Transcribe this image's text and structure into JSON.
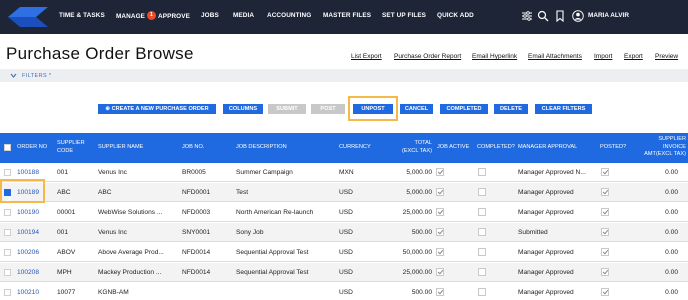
{
  "nav": {
    "items": [
      "TIME & TASKS",
      "MANAGE",
      "APPROVE",
      "JOBS",
      "MEDIA",
      "ACCOUNTING",
      "MASTER FILES",
      "SET UP FILES",
      "QUICK ADD"
    ],
    "badge": "1",
    "user_name": "MARIA ALVIR",
    "icons": [
      "logo-icon",
      "sliders-icon",
      "search-icon",
      "bookmark-icon",
      "user-icon"
    ]
  },
  "page": {
    "title": "Purchase Order Browse",
    "links": [
      "List Export",
      "Purchase Order Report",
      "Email Hyperlink",
      "Email Attachments",
      "Import",
      "Export",
      "Preview"
    ]
  },
  "filters": {
    "label": "FILTERS *"
  },
  "actions": {
    "create": "⊕ CREATE A NEW PURCHASE ORDER",
    "columns": "COLUMNS",
    "submit": "SUBMIT",
    "post": "POST",
    "unpost": "UNPOST",
    "cancel": "CANCEL",
    "completed": "COMPLETED",
    "delete": "DELETE",
    "clear_filters": "CLEAR FILTERS"
  },
  "table": {
    "headers": {
      "order_no": "ORDER NO",
      "supplier_code": [
        "SUPPLIER",
        "CODE"
      ],
      "supplier_name": "SUPPLIER NAME",
      "job_no": "JOB NO.",
      "job_description": "JOB DESCRIPTION",
      "currency": "CURRENCY",
      "total": [
        "TOTAL",
        "(EXCL TAX)"
      ],
      "job_active": "JOB ACTIVE",
      "completed": "COMPLETED?",
      "manager_approval": "MANAGER APPROVAL",
      "posted": "POSTED?",
      "supplier_invoice": [
        "SUPPLIER",
        "INVOICE",
        "AMT(EXCL TAX)"
      ]
    },
    "rows": [
      {
        "selected": false,
        "order_no": "100188",
        "supplier_code": "001",
        "supplier_name": "Venus Inc",
        "job_no": "BR0005",
        "job_description": "Summer Campaign",
        "currency": "MXN",
        "total": "5,000.00",
        "job_active": true,
        "completed": false,
        "manager_approval": "Manager Approved N...",
        "posted": true,
        "supplier_invoice": "0.00"
      },
      {
        "selected": true,
        "order_no": "100189",
        "supplier_code": "ABC",
        "supplier_name": "ABC",
        "job_no": "NFD0001",
        "job_description": "Test",
        "currency": "USD",
        "total": "5,000.00",
        "job_active": true,
        "completed": false,
        "manager_approval": "Manager Approved",
        "posted": true,
        "supplier_invoice": "0.00"
      },
      {
        "selected": false,
        "order_no": "100190",
        "supplier_code": "00001",
        "supplier_name": "WebWise Solutions ...",
        "job_no": "NFD0003",
        "job_description": "North American Re-launch",
        "currency": "USD",
        "total": "25,000.00",
        "job_active": true,
        "completed": false,
        "manager_approval": "Manager Approved",
        "posted": true,
        "supplier_invoice": "0.00"
      },
      {
        "selected": false,
        "order_no": "100194",
        "supplier_code": "001",
        "supplier_name": "Venus Inc",
        "job_no": "SNY0001",
        "job_description": "Sony Job",
        "currency": "USD",
        "total": "500.00",
        "job_active": true,
        "completed": false,
        "manager_approval": "Submitted",
        "posted": true,
        "supplier_invoice": "0.00"
      },
      {
        "selected": false,
        "order_no": "100206",
        "supplier_code": "ABOV",
        "supplier_name": "Above Average Prod...",
        "job_no": "NFD0014",
        "job_description": "Sequential Approval Test",
        "currency": "USD",
        "total": "50,000.00",
        "job_active": true,
        "completed": false,
        "manager_approval": "Manager Approved",
        "posted": true,
        "supplier_invoice": "0.00"
      },
      {
        "selected": false,
        "order_no": "100208",
        "supplier_code": "MPH",
        "supplier_name": "Mackey Production ...",
        "job_no": "NFD0014",
        "job_description": "Sequential Approval Test",
        "currency": "USD",
        "total": "25,000.00",
        "job_active": true,
        "completed": false,
        "manager_approval": "Manager Approved",
        "posted": true,
        "supplier_invoice": "0.00"
      },
      {
        "selected": false,
        "order_no": "100210",
        "supplier_code": "10077",
        "supplier_name": "KGNB-AM",
        "job_no": "",
        "job_description": "",
        "currency": "USD",
        "total": "500.00",
        "job_active": true,
        "completed": false,
        "manager_approval": "Manager Approved",
        "posted": true,
        "supplier_invoice": "0.00"
      }
    ]
  },
  "colors": {
    "nav_bg": "#1d2537",
    "accent": "#1f6ae1",
    "highlight": "#f5b94a",
    "link": "#2357b9",
    "disabled": "#c8c8c8"
  }
}
